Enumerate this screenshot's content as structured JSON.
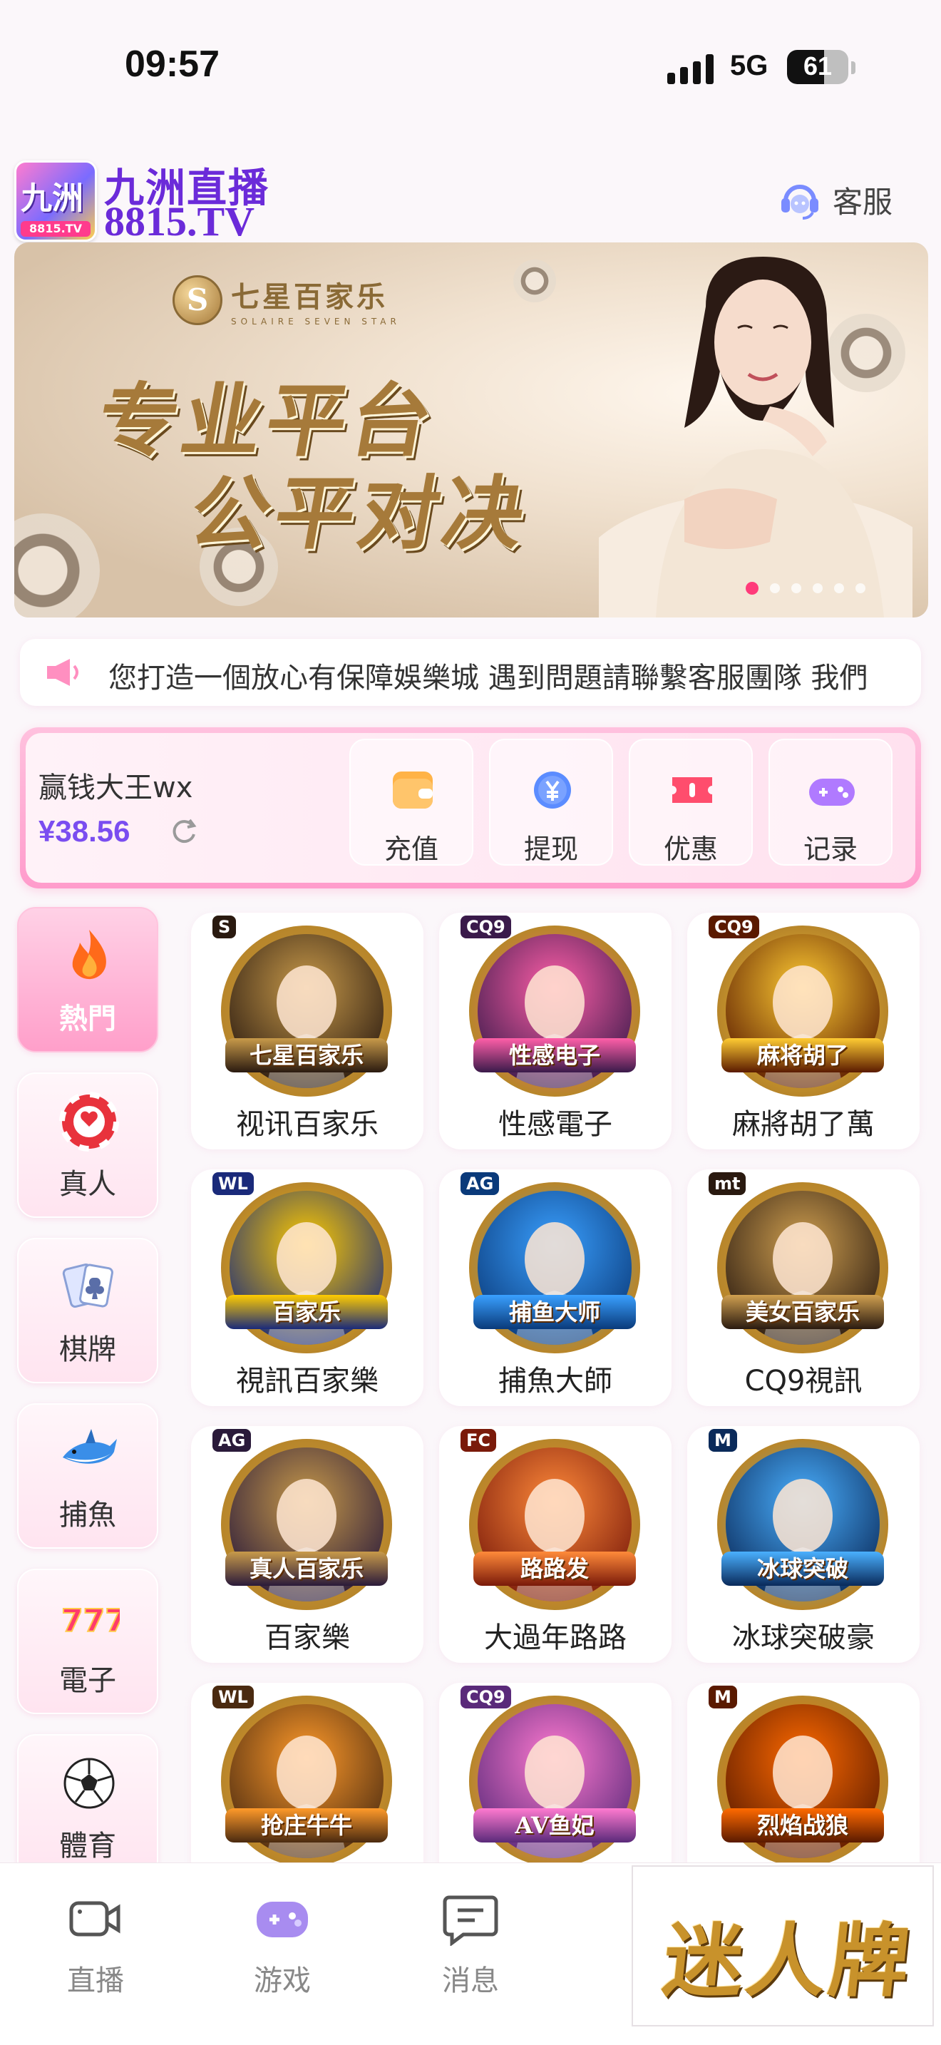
{
  "status_bar": {
    "time": "09:57",
    "network": "5G",
    "battery": "61",
    "battery_fraction": 0.61
  },
  "header": {
    "logo_glyph": "九洲",
    "logo_badge": "8815.TV",
    "brand_cn": "九洲直播",
    "brand_en": "8815.TV",
    "support_label": "客服"
  },
  "banner": {
    "brand_name": "七星百家乐",
    "brand_sub": "SOLAIRE SEVEN STAR",
    "brand_coin": "S",
    "slogan_line1": "专业平台",
    "slogan_line2": "公平对决",
    "slide_count": 6,
    "active_slide": 1
  },
  "notice": {
    "text": "您打造一個放心有保障娛樂城  遇到問題請聯繫客服團隊  我們"
  },
  "wallet": {
    "username": "赢钱大王wx",
    "balance": "¥38.56",
    "actions": [
      {
        "label": "充值",
        "icon": "wallet-icon"
      },
      {
        "label": "提现",
        "icon": "yen-coin-icon"
      },
      {
        "label": "优惠",
        "icon": "ticket-icon"
      },
      {
        "label": "记录",
        "icon": "gamepad-icon"
      }
    ]
  },
  "categories": [
    {
      "label": "熱門",
      "icon": "flame-icon",
      "active": true
    },
    {
      "label": "真人",
      "icon": "poker-chip-icon",
      "active": false
    },
    {
      "label": "棋牌",
      "icon": "playing-cards-icon",
      "active": false
    },
    {
      "label": "捕魚",
      "icon": "shark-icon",
      "active": false
    },
    {
      "label": "電子",
      "icon": "slot-777-icon",
      "active": false
    },
    {
      "label": "體育",
      "icon": "soccer-ball-icon",
      "active": false
    }
  ],
  "games": [
    {
      "name": "视讯百家乐",
      "provider": "S",
      "tag": "七星百家乐",
      "colors": [
        "#2a1a10",
        "#c89a4a"
      ]
    },
    {
      "name": "性感電子",
      "provider": "CQ9",
      "tag": "性感电子",
      "colors": [
        "#3a1a4a",
        "#ff5fa8"
      ]
    },
    {
      "name": "麻將胡了萬",
      "provider": "CQ9",
      "tag": "麻将胡了",
      "colors": [
        "#5a1a00",
        "#ffcc33"
      ]
    },
    {
      "name": "視訊百家樂",
      "provider": "WL",
      "tag": "百家乐",
      "colors": [
        "#1a2a7a",
        "#ffcc00"
      ]
    },
    {
      "name": "捕魚大師",
      "provider": "AG",
      "tag": "捕鱼大师",
      "colors": [
        "#0a3a7a",
        "#3aa0ff"
      ]
    },
    {
      "name": "CQ9視訊",
      "provider": "mt",
      "tag": "美女百家乐",
      "colors": [
        "#2a1a10",
        "#d0a050"
      ]
    },
    {
      "name": "百家樂",
      "provider": "AG",
      "tag": "真人百家乐",
      "colors": [
        "#2a1a3a",
        "#c89a4a"
      ]
    },
    {
      "name": "大過年路路",
      "provider": "FC",
      "tag": "路路发",
      "colors": [
        "#7a1a0a",
        "#ff8a3a"
      ]
    },
    {
      "name": "冰球突破豪",
      "provider": "M",
      "tag": "冰球突破",
      "colors": [
        "#0a2a5a",
        "#4ab0ff"
      ]
    },
    {
      "name": "",
      "provider": "WL",
      "tag": "抢庄牛牛",
      "colors": [
        "#4a2a10",
        "#ff9a2a"
      ]
    },
    {
      "name": "",
      "provider": "CQ9",
      "tag": "AV鱼妃",
      "colors": [
        "#5a2a7a",
        "#ff7ad0"
      ]
    },
    {
      "name": "",
      "provider": "M",
      "tag": "烈焰战狼",
      "colors": [
        "#5a1a00",
        "#ff6a00"
      ]
    }
  ],
  "tabbar": [
    {
      "label": "直播",
      "icon": "video-camera-icon"
    },
    {
      "label": "游戏",
      "icon": "gamepad-icon"
    },
    {
      "label": "消息",
      "icon": "message-icon"
    }
  ],
  "promo": {
    "text": "迷人牌"
  }
}
